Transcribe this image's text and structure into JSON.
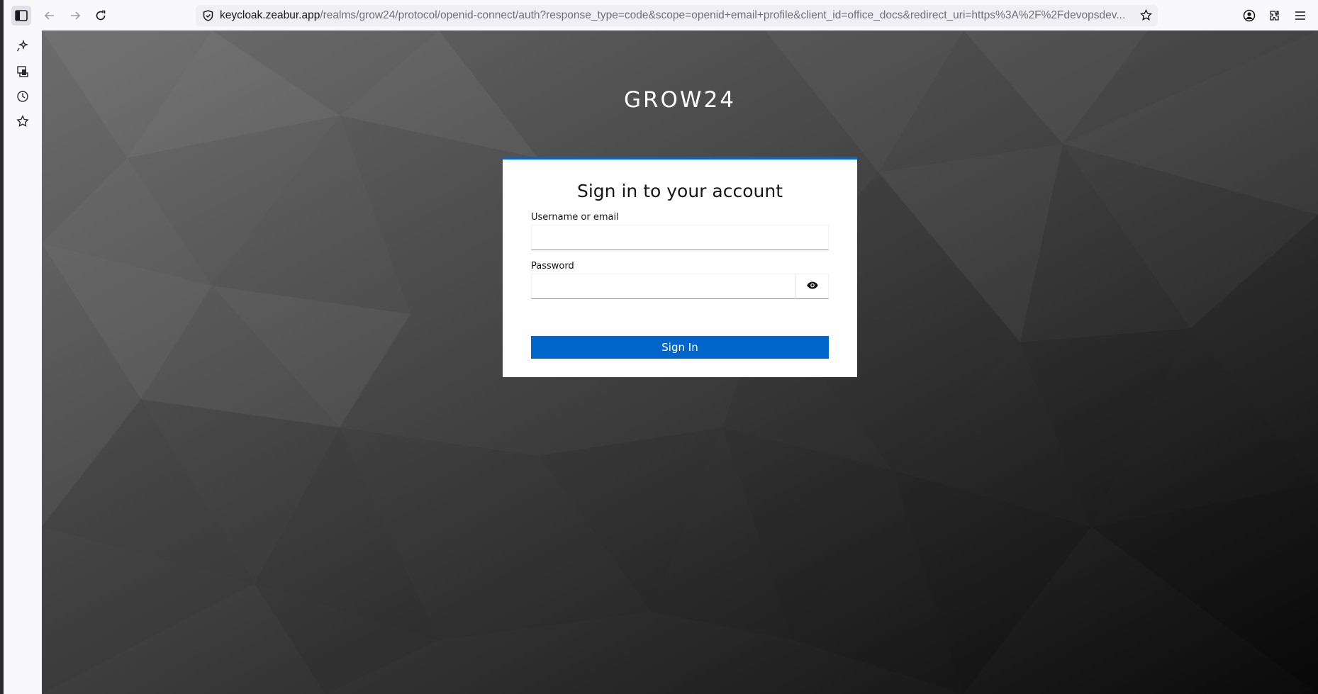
{
  "browser": {
    "url_host": "keycloak.zeabur.app",
    "url_path": "/realms/grow24/protocol/openid-connect/auth?response_type=code&scope=openid+email+profile&client_id=office_docs&redirect_uri=https%3A%2F%2Fdevopsdev...",
    "icons": {
      "sidebar_toggle": "sidebar-toggle-icon",
      "back": "back-arrow-icon",
      "forward": "forward-arrow-icon",
      "reload": "reload-icon",
      "site_info": "shield-icon",
      "bookmark": "star-icon",
      "account": "account-icon",
      "extensions": "puzzle-icon",
      "menu": "hamburger-menu-icon"
    }
  },
  "sidebar": {
    "items": [
      {
        "icon": "ai-sparkle-icon"
      },
      {
        "icon": "synced-tabs-icon"
      },
      {
        "icon": "history-icon"
      },
      {
        "icon": "bookmarks-star-icon"
      }
    ]
  },
  "page": {
    "realm_name": "GROW24",
    "card_title": "Sign in to your account",
    "username_label": "Username or email",
    "username_value": "",
    "password_label": "Password",
    "password_value": "",
    "show_password_icon": "eye-icon",
    "sign_in_label": "Sign In",
    "accent_color": "#0066cc"
  }
}
